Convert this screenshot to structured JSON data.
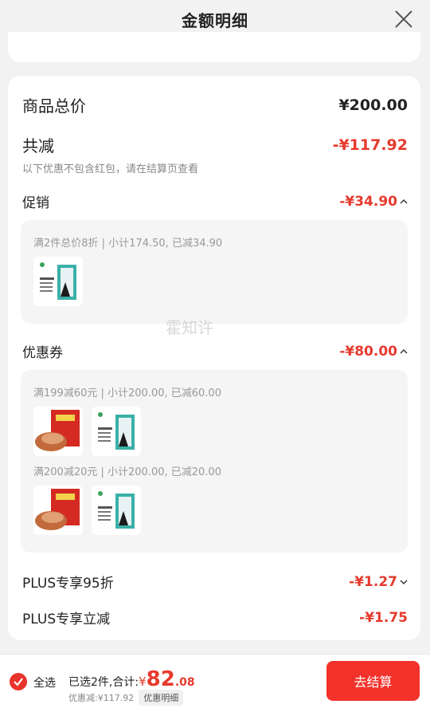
{
  "header": {
    "title": "金额明细"
  },
  "total": {
    "label": "商品总价",
    "value": "¥200.00"
  },
  "reduce": {
    "label": "共减",
    "value": "-¥117.92",
    "note": "以下优惠不包含红包，请在结算页查看"
  },
  "promo": {
    "label": "促销",
    "value": "-¥34.90",
    "rule": "满2件总价8折 | 小计174.50, 已减34.90"
  },
  "coupon": {
    "label": "优惠券",
    "value": "-¥80.00",
    "rule1": "满199减60元 | 小计200.00, 已减60.00",
    "rule2": "满200减20元 | 小计200.00, 已减20.00"
  },
  "plus": {
    "label": "PLUS专享95折",
    "value": "-¥1.27"
  },
  "plus_reduce": {
    "label": "PLUS专享立减",
    "value": "-¥1.75"
  },
  "watermark": "霍知许",
  "footer": {
    "select_all": "全选",
    "selected_text": "已选2件,合计:",
    "currency": "¥",
    "price_int": "82",
    "price_dec": ".08",
    "discount_text": "优惠减:¥117.92",
    "detail_btn": "优惠明细",
    "checkout": "去结算"
  },
  "colors": {
    "accent": "#e63a2e",
    "button": "#f2322b"
  }
}
